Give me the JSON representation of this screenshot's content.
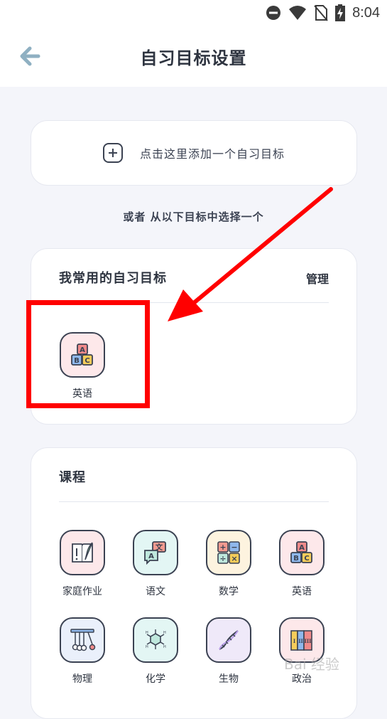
{
  "status_bar": {
    "time": "8:04",
    "icons": [
      "dnd-icon",
      "wifi-icon",
      "no-sim-icon",
      "battery-charging-icon"
    ]
  },
  "app_bar": {
    "title": "自习目标设置",
    "back_icon": "back-arrow-icon"
  },
  "add_goal": {
    "label": "点击这里添加一个自习目标",
    "icon": "plus-square-icon"
  },
  "or_text": "或者 从以下目标中选择一个",
  "favorites": {
    "title": "我常用的自习目标",
    "manage_label": "管理",
    "items": [
      {
        "label": "英语",
        "icon": "abc-blocks-icon"
      }
    ]
  },
  "courses": {
    "title": "课程",
    "items": [
      {
        "label": "家庭作业",
        "icon": "book-quill-icon",
        "bg": "#fde8ea"
      },
      {
        "label": "语文",
        "icon": "chat-translate-icon",
        "bg": "#e3f6f4"
      },
      {
        "label": "数学",
        "icon": "math-operators-icon",
        "bg": "#fdf3df"
      },
      {
        "label": "英语",
        "icon": "abc-blocks-icon",
        "bg": "#fde8ea"
      },
      {
        "label": "物理",
        "icon": "newton-cradle-icon",
        "bg": "#eaf0fb"
      },
      {
        "label": "化学",
        "icon": "molecule-icon",
        "bg": "#e3f6f4"
      },
      {
        "label": "生物",
        "icon": "dna-icon",
        "bg": "#efe9f9"
      },
      {
        "label": "政治",
        "icon": "books-icon",
        "bg": "#fde8ea"
      }
    ]
  },
  "watermark": "Bai 经验",
  "colors": {
    "annotation_red": "#ff0000",
    "back_arrow": "#8fb0c2"
  }
}
